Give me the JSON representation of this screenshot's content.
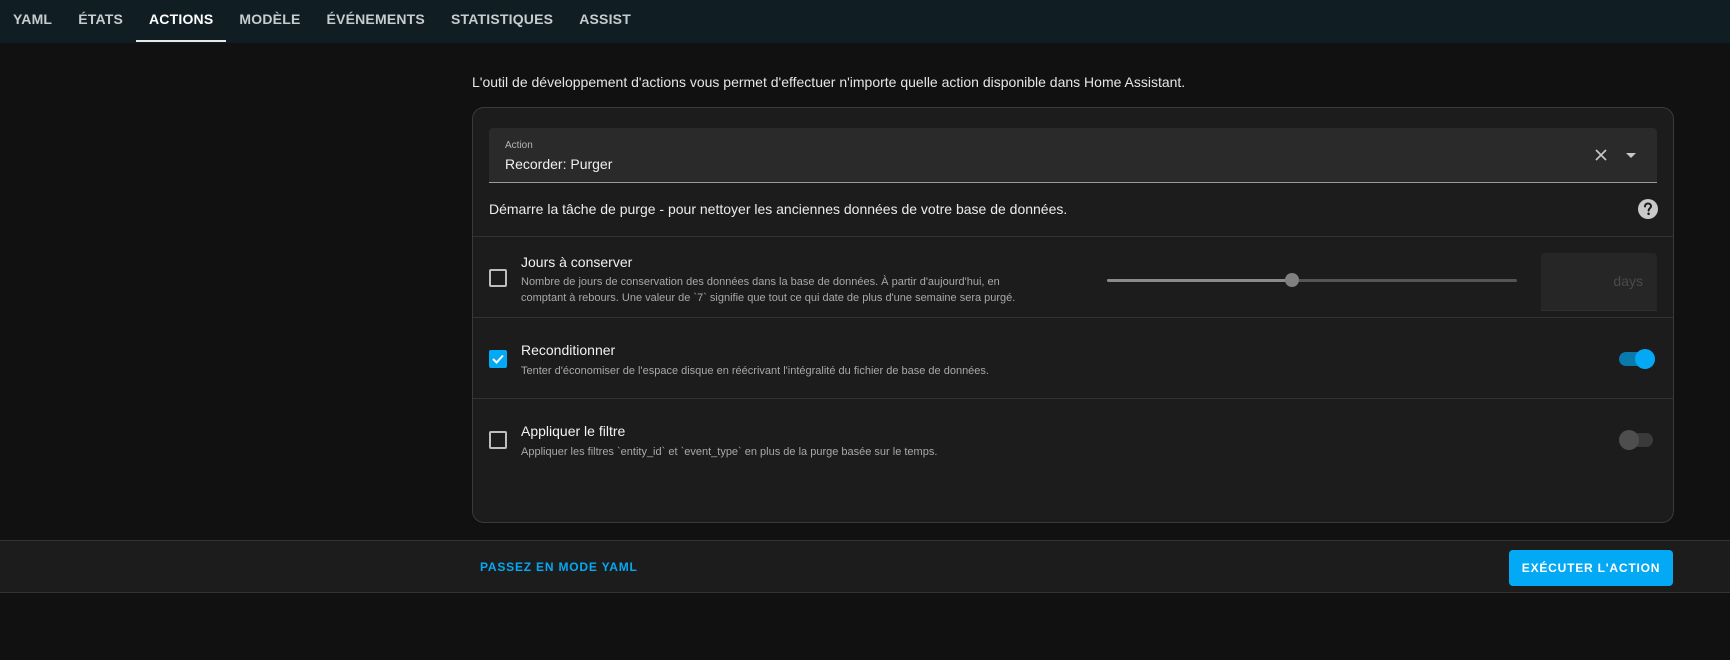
{
  "tabs": [
    {
      "label": "YAML",
      "active": false
    },
    {
      "label": "ÉTATS",
      "active": false
    },
    {
      "label": "ACTIONS",
      "active": true
    },
    {
      "label": "MODÈLE",
      "active": false
    },
    {
      "label": "ÉVÉNEMENTS",
      "active": false
    },
    {
      "label": "STATISTIQUES",
      "active": false
    },
    {
      "label": "ASSIST",
      "active": false
    }
  ],
  "intro_text": "L'outil de développement d'actions vous permet d'effectuer n'importe quelle action disponible dans Home Assistant.",
  "action": {
    "label": "Action",
    "value": "Recorder: Purger",
    "clear_icon": "close-icon",
    "dropdown_icon": "chevron-down-icon"
  },
  "action_description": "Démarre la tâche de purge - pour nettoyer les anciennes données de votre base de données.",
  "help_icon": "help-circle-icon",
  "fields": [
    {
      "title": "Jours à conserver",
      "description_line1": "Nombre de jours de conservation des données dans la base de données. À partir d'aujourd'hui, en",
      "description_line2": "comptant à rebours. Une valeur de `7` signifie que tout ce qui date de plus d'une semaine sera purgé.",
      "checked": false,
      "slider_fraction": 0.45,
      "unit": "days"
    },
    {
      "title": "Reconditionner",
      "description": "Tenter d'économiser de l'espace disque en réécrivant l'intégralité du fichier de base de données.",
      "checked": true,
      "toggle_on": true
    },
    {
      "title": "Appliquer le filtre",
      "description": "Appliquer les filtres `entity_id` et `event_type` en plus de la purge basée sur le temps.",
      "checked": false,
      "toggle_on": false
    }
  ],
  "footer": {
    "yaml_link": "PASSEZ EN MODE YAML",
    "run_button": "EXÉCUTER L'ACTION"
  },
  "colors": {
    "accent": "#03a9f4",
    "topbar": "#101e24",
    "background": "#111111",
    "card": "#1c1c1c"
  }
}
